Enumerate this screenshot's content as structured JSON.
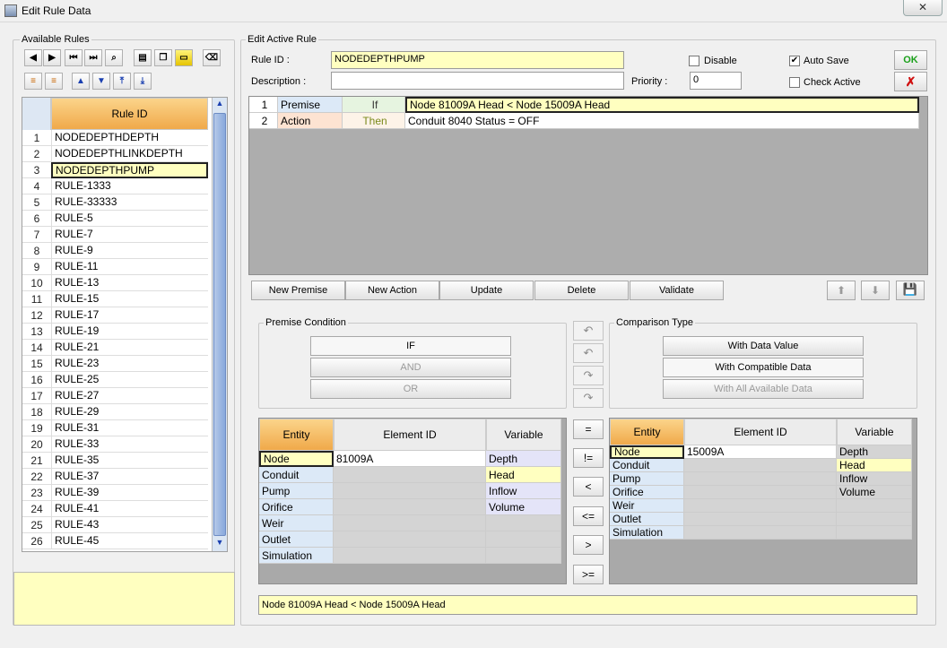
{
  "window": {
    "title": "Edit Rule Data",
    "close_label": "✕"
  },
  "available_rules": {
    "label": "Available Rules",
    "column_header": "Rule ID",
    "rows": [
      {
        "n": "1",
        "id": "NODEDEPTHDEPTH"
      },
      {
        "n": "2",
        "id": "NODEDEPTHLINKDEPTH"
      },
      {
        "n": "3",
        "id": "NODEDEPTHPUMP"
      },
      {
        "n": "4",
        "id": "RULE-1333"
      },
      {
        "n": "5",
        "id": "RULE-33333"
      },
      {
        "n": "6",
        "id": "RULE-5"
      },
      {
        "n": "7",
        "id": "RULE-7"
      },
      {
        "n": "8",
        "id": "RULE-9"
      },
      {
        "n": "9",
        "id": "RULE-11"
      },
      {
        "n": "10",
        "id": "RULE-13"
      },
      {
        "n": "11",
        "id": "RULE-15"
      },
      {
        "n": "12",
        "id": "RULE-17"
      },
      {
        "n": "13",
        "id": "RULE-19"
      },
      {
        "n": "14",
        "id": "RULE-21"
      },
      {
        "n": "15",
        "id": "RULE-23"
      },
      {
        "n": "16",
        "id": "RULE-25"
      },
      {
        "n": "17",
        "id": "RULE-27"
      },
      {
        "n": "18",
        "id": "RULE-29"
      },
      {
        "n": "19",
        "id": "RULE-31"
      },
      {
        "n": "20",
        "id": "RULE-33"
      },
      {
        "n": "21",
        "id": "RULE-35"
      },
      {
        "n": "22",
        "id": "RULE-37"
      },
      {
        "n": "23",
        "id": "RULE-39"
      },
      {
        "n": "24",
        "id": "RULE-41"
      },
      {
        "n": "25",
        "id": "RULE-43"
      },
      {
        "n": "26",
        "id": "RULE-45"
      }
    ],
    "selected_index": 2
  },
  "edit_active_rule": {
    "label": "Edit Active Rule",
    "rule_id_label": "Rule ID :",
    "rule_id_value": "NODEDEPTHPUMP",
    "description_label": "Description :",
    "description_value": "",
    "disable_label": "Disable",
    "disable_checked": false,
    "auto_save_label": "Auto Save",
    "auto_save_checked": true,
    "check_active_label": "Check Active",
    "check_active_checked": false,
    "priority_label": "Priority :",
    "priority_value": "0",
    "ok_label": "OK",
    "cancel_label": "✗"
  },
  "rule_lines": [
    {
      "n": "1",
      "type": "Premise",
      "kw": "If",
      "text": "Node 81009A Head < Node 15009A Head"
    },
    {
      "n": "2",
      "type": "Action",
      "kw": "Then",
      "text": "Conduit 8040 Status = OFF"
    }
  ],
  "actions": {
    "new_premise": "New Premise",
    "new_action": "New Action",
    "update": "Update",
    "delete": "Delete",
    "validate": "Validate"
  },
  "premise_condition": {
    "label": "Premise Condition",
    "if": "IF",
    "and": "AND",
    "or": "OR"
  },
  "comparison_type": {
    "label": "Comparison Type",
    "with_data_value": "With Data Value",
    "with_compatible_data": "With Compatible Data",
    "with_all_available_data": "With All Available Data"
  },
  "operators": [
    "=",
    "!=",
    "<",
    "<=",
    ">",
    ">="
  ],
  "left_grid": {
    "headers": [
      "Entity",
      "Element ID",
      "Variable"
    ],
    "entities": [
      "Node",
      "Conduit",
      "Pump",
      "Orifice",
      "Weir",
      "Outlet",
      "Simulation"
    ],
    "element_id": "81009A",
    "variables": [
      "Depth",
      "Head",
      "Inflow",
      "Volume"
    ]
  },
  "right_grid": {
    "headers": [
      "Entity",
      "Element ID",
      "Variable"
    ],
    "entities": [
      "Node",
      "Conduit",
      "Pump",
      "Orifice",
      "Weir",
      "Outlet",
      "Simulation"
    ],
    "element_id": "15009A",
    "variables": [
      "Depth",
      "Head",
      "Inflow",
      "Volume"
    ]
  },
  "status_text": "Node 81009A Head < Node 15009A Head",
  "colors": {
    "accent_orange": "#f0a94a",
    "selection_yellow": "#ffffc0",
    "ok_green": "#1aa01a",
    "cancel_red": "#d01010"
  }
}
